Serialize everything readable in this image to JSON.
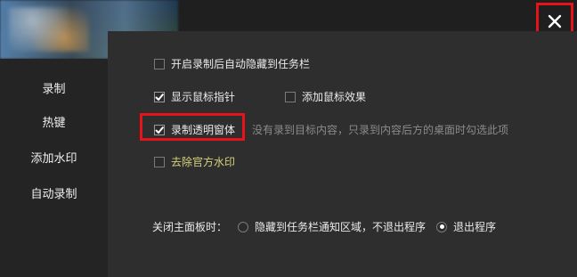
{
  "window": {
    "close_icon": "close-icon"
  },
  "sidebar": {
    "items": [
      {
        "label": "录制"
      },
      {
        "label": "热键"
      },
      {
        "label": "添加水印"
      },
      {
        "label": "自动录制"
      }
    ]
  },
  "settings": {
    "auto_hide": {
      "label": "开启录制后自动隐藏到任务栏",
      "checked": false
    },
    "show_cursor": {
      "label": "显示鼠标指针",
      "checked": true
    },
    "cursor_effect": {
      "label": "添加鼠标效果",
      "checked": false
    },
    "record_transparent": {
      "label": "录制透明窗体",
      "checked": true,
      "hint": "没有录到目标内容，只录到内容后方的桌面时勾选此项"
    },
    "remove_watermark": {
      "label": "去除官方水印",
      "checked": false,
      "label_color": "#d8d27a"
    }
  },
  "close_panel": {
    "label": "关闭主面板时：",
    "options": [
      {
        "label": "隐藏到任务栏通知区域，不退出程序",
        "selected": false
      },
      {
        "label": "退出程序",
        "selected": true
      }
    ]
  },
  "colors": {
    "highlight_red": "#e6131a",
    "background": "#2b2b2b"
  }
}
